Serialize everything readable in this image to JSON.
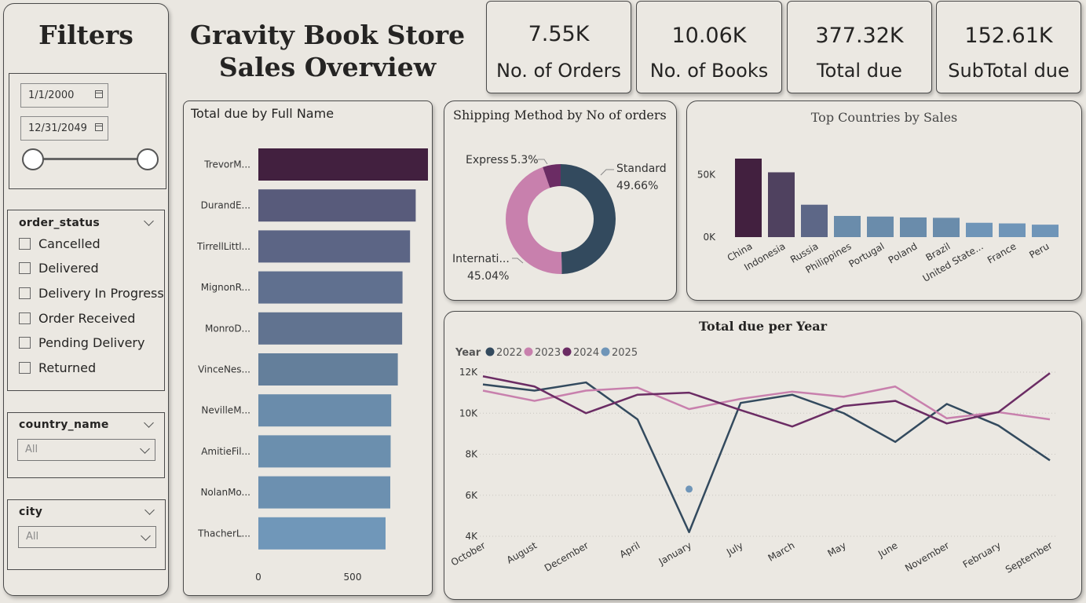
{
  "filters": {
    "title": "Filters",
    "date_start": "1/1/2000",
    "date_end": "12/31/2049",
    "order_status": {
      "title": "order_status",
      "options": [
        "Cancelled",
        "Delivered",
        "Delivery In Progress",
        "Order Received",
        "Pending Delivery",
        "Returned"
      ]
    },
    "country": {
      "title": "country_name",
      "selected": "All"
    },
    "city": {
      "title": "city",
      "selected": "All"
    }
  },
  "header": {
    "line1": "Gravity Book Store",
    "line2": "Sales Overview"
  },
  "kpis": [
    {
      "value": "7.55K",
      "label": "No. of Orders"
    },
    {
      "value": "10.06K",
      "label": "No. of Books"
    },
    {
      "value": "377.32K",
      "label": "Total due"
    },
    {
      "value": "152.61K",
      "label": "SubTotal due"
    }
  ],
  "colors": {
    "accent_dark": "#42203f",
    "grey_blue": "#334a5e",
    "pink": "#c880ad",
    "purple": "#6b2c64",
    "light_blue": "#6f95b8"
  },
  "chart_data": [
    {
      "type": "bar",
      "orientation": "horizontal",
      "title": "Total due by Full Name",
      "categories": [
        "TrevorM...",
        "DurandE...",
        "TirrellLittl...",
        "MignonR...",
        "MonroD...",
        "VinceNes...",
        "NevilleM...",
        "AmitieFil...",
        "NolanMo...",
        "ThacherL..."
      ],
      "values": [
        900,
        835,
        805,
        765,
        763,
        740,
        705,
        702,
        700,
        675
      ],
      "xticks": [
        "0",
        "500"
      ],
      "xlim": [
        0,
        1000
      ],
      "colors": [
        "#42203f",
        "#585b7b",
        "#5c6585",
        "#60708f",
        "#617390",
        "#647f9b",
        "#6a8cab",
        "#6b8fae",
        "#6c90b0",
        "#7097b9"
      ]
    },
    {
      "type": "pie",
      "title": "Shipping Method by No of orders",
      "slices": [
        {
          "name": "Standard",
          "value": 49.66,
          "label": "49.66%",
          "color": "#334a5e"
        },
        {
          "name": "Internati...",
          "value": 45.04,
          "label": "45.04%",
          "color": "#c880ad"
        },
        {
          "name": "Express",
          "value": 5.3,
          "label": "5.3%",
          "color": "#6b2c64"
        }
      ]
    },
    {
      "type": "bar",
      "title": "Top Countries by Sales",
      "categories": [
        "China",
        "Indonesia",
        "Russia",
        "Philippines",
        "Portugal",
        "Poland",
        "Brazil",
        "United State...",
        "France",
        "Peru"
      ],
      "values": [
        63000,
        52000,
        26000,
        17000,
        16500,
        15800,
        15500,
        11500,
        11000,
        10000
      ],
      "yticks": [
        "0K",
        "50K"
      ],
      "ylim": [
        0,
        63000
      ],
      "colors": [
        "#42203f",
        "#4f415f",
        "#5d6787",
        "#6a8cab",
        "#6a8cab",
        "#6a8cab",
        "#6a8cab",
        "#6f95b8",
        "#6f95b8",
        "#6f95b8"
      ]
    },
    {
      "type": "line",
      "title": "Total due per Year",
      "legend_title": "Year",
      "categories": [
        "October",
        "August",
        "December",
        "April",
        "January",
        "July",
        "March",
        "May",
        "June",
        "November",
        "February",
        "September"
      ],
      "yticks": [
        "4K",
        "6K",
        "8K",
        "10K",
        "12K"
      ],
      "ylim": [
        4000,
        12000
      ],
      "series": [
        {
          "name": "2022",
          "color": "#334a5e",
          "values": [
            11400,
            11100,
            11500,
            9700,
            4200,
            10500,
            10900,
            10000,
            8600,
            10450,
            9400,
            7700
          ]
        },
        {
          "name": "2023",
          "color": "#c880ad",
          "values": [
            11100,
            10600,
            11100,
            11250,
            10200,
            10700,
            11050,
            10800,
            11300,
            9750,
            10050,
            9700
          ]
        },
        {
          "name": "2024",
          "color": "#6b2c64",
          "values": [
            11800,
            11300,
            10000,
            10900,
            11000,
            10150,
            9350,
            10350,
            10600,
            9500,
            10050,
            11950
          ]
        },
        {
          "name": "2025",
          "color": "#6f95b8",
          "values": [
            null,
            null,
            null,
            null,
            6300,
            null,
            null,
            null,
            null,
            null,
            null,
            null
          ]
        }
      ]
    }
  ]
}
